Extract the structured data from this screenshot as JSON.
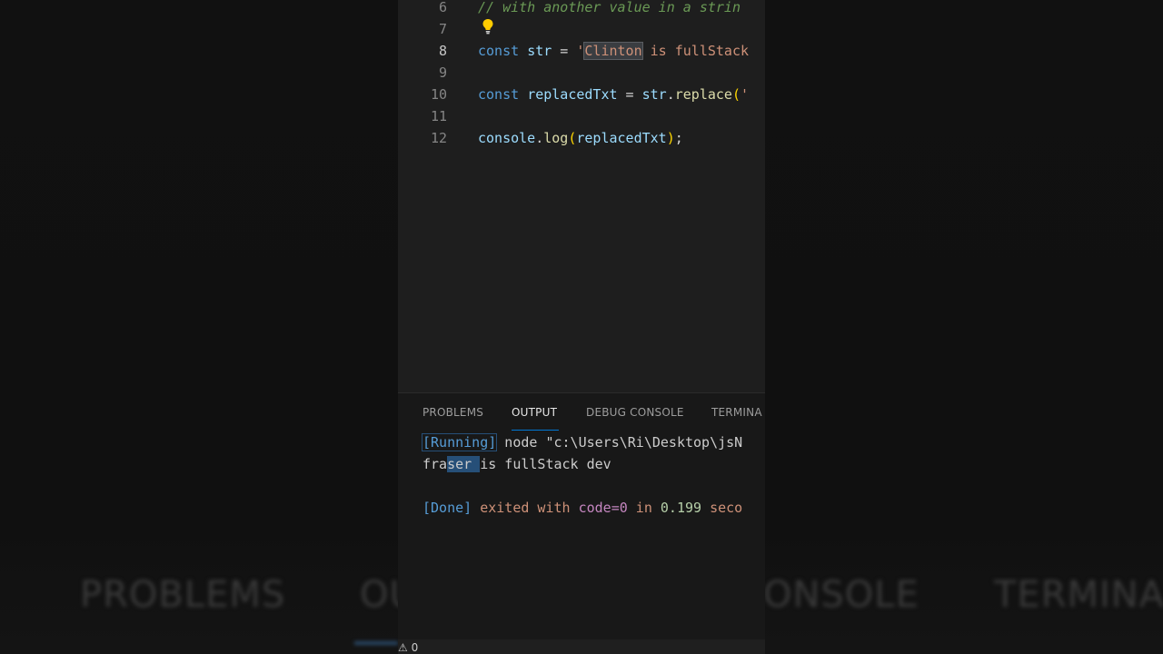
{
  "background": {
    "blurred_tabs": [
      "PROBLEMS",
      "OU",
      "ONSOLE",
      "TERMINA"
    ]
  },
  "editor": {
    "lines": [
      {
        "num": "6",
        "text": "//  with another value in a strin"
      },
      {
        "num": "7",
        "text": ""
      },
      {
        "num": "8",
        "kw": "const",
        "name": "str",
        "eq": " = ",
        "str_open": "'",
        "str_hl": "Clinton",
        "str_rest": " is fullStack"
      },
      {
        "num": "9",
        "text": ""
      },
      {
        "num": "10",
        "kw": "const",
        "name": "replacedTxt",
        "eq": " = ",
        "obj": "str",
        "dot": ".",
        "fn": "replace",
        "paren": "(",
        "tail": "'"
      },
      {
        "num": "11",
        "text": ""
      },
      {
        "num": "12",
        "obj": "console",
        "dot": ".",
        "fn": "log",
        "paren_open": "(",
        "arg": "replacedTxt",
        "paren_close": ")",
        "semi": ";"
      }
    ],
    "bulb_icon": "lightbulb-icon"
  },
  "panel": {
    "tabs": [
      {
        "label": "PROBLEMS",
        "active": false
      },
      {
        "label": "OUTPUT",
        "active": true
      },
      {
        "label": "DEBUG CONSOLE",
        "active": false
      },
      {
        "label": "TERMINA",
        "active": false
      }
    ],
    "output": {
      "running_tag": "[Running]",
      "running_cmd": " node \"c:\\Users\\Ri\\Desktop\\jsN",
      "result_pre": "fra",
      "result_sel": "ser ",
      "result_post": "is fullStack dev",
      "done_tag": "[Done]",
      "done_text1": " exited with ",
      "done_code": "code=0",
      "done_text2": " in ",
      "done_time": "0.199",
      "done_text3": " seco"
    }
  },
  "status": {
    "warnings": "0"
  },
  "colors": {
    "editor_bg": "#1e1e1e",
    "accent": "#0078d4",
    "keyword": "#569cd6",
    "string": "#ce9178",
    "comment": "#6a9955"
  }
}
